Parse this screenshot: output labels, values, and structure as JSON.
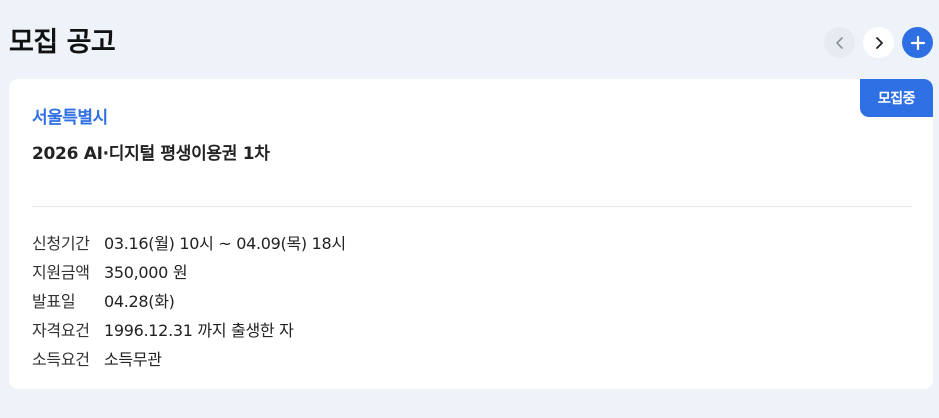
{
  "header": {
    "title": "모집 공고",
    "nav": {
      "prev_icon": "chevron-left-icon",
      "next_icon": "chevron-right-icon",
      "add_icon": "plus-icon"
    }
  },
  "card": {
    "badge": "모집중",
    "region": "서울특별시",
    "program": "2026 AI·디지털 평생이용권 1차",
    "details": [
      {
        "label": "신청기간",
        "value": "03.16(월) 10시 ~ 04.09(목) 18시"
      },
      {
        "label": "지원금액",
        "value": "350,000 원"
      },
      {
        "label": "발표일",
        "value": "04.28(화)"
      },
      {
        "label": "자격요건",
        "value": "1996.12.31 까지 출생한 자"
      },
      {
        "label": "소득요건",
        "value": "소득무관"
      }
    ]
  },
  "colors": {
    "accent": "#2f6fe4",
    "background": "#eef3fa",
    "card": "#ffffff"
  }
}
